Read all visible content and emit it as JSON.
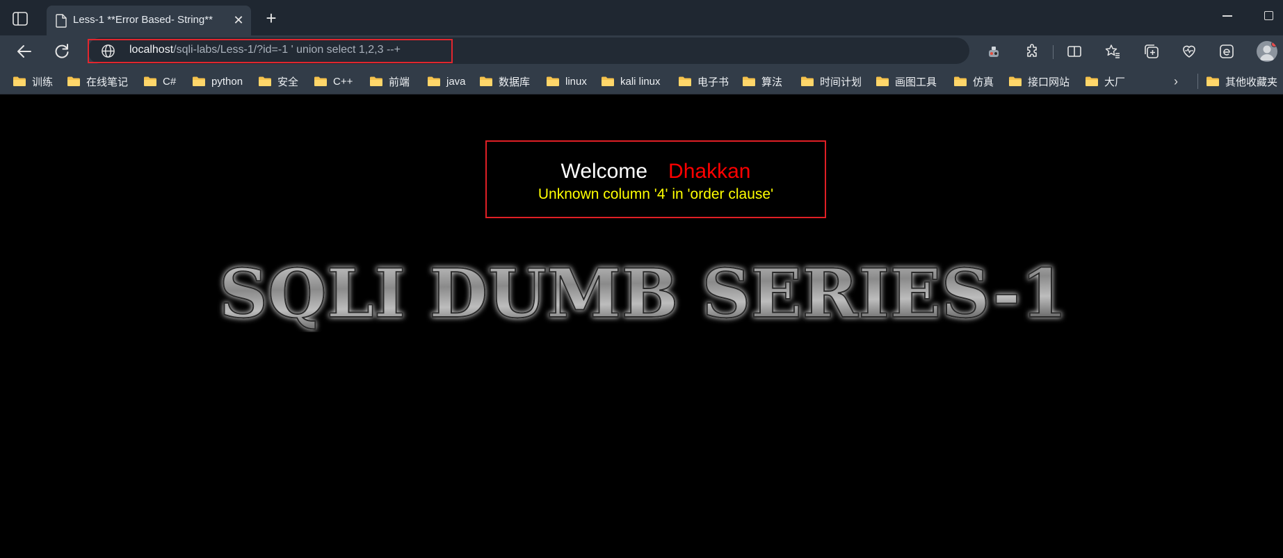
{
  "browser": {
    "tab_title": "Less-1 **Error Based- String**",
    "url_host": "localhost",
    "url_path": "/sqli-labs/Less-1/?id=-1 ' union select 1,2,3 --+"
  },
  "bookmarks": [
    {
      "label": "训练"
    },
    {
      "label": "在线笔记"
    },
    {
      "label": "C#"
    },
    {
      "label": "python"
    },
    {
      "label": "安全"
    },
    {
      "label": "C++"
    },
    {
      "label": "前端"
    },
    {
      "label": "java"
    },
    {
      "label": "数据库"
    },
    {
      "label": "linux"
    },
    {
      "label": "kali linux"
    },
    {
      "label": "电子书"
    },
    {
      "label": "算法"
    },
    {
      "label": "时间计划"
    },
    {
      "label": "画图工具"
    },
    {
      "label": "仿真"
    },
    {
      "label": "接口网站"
    },
    {
      "label": "大厂"
    }
  ],
  "other_bookmarks": "其他收藏夹",
  "page": {
    "welcome": "Welcome",
    "username": "Dhakkan",
    "error_message": "Unknown column '4' in 'order clause'",
    "banner_text": "SQLI DUMB SERIES-1"
  },
  "colors": {
    "welcome": "#ffffff",
    "username": "#ff0000",
    "error": "#ffff00",
    "box_border": "#e01f25",
    "page_bg": "#000000"
  }
}
